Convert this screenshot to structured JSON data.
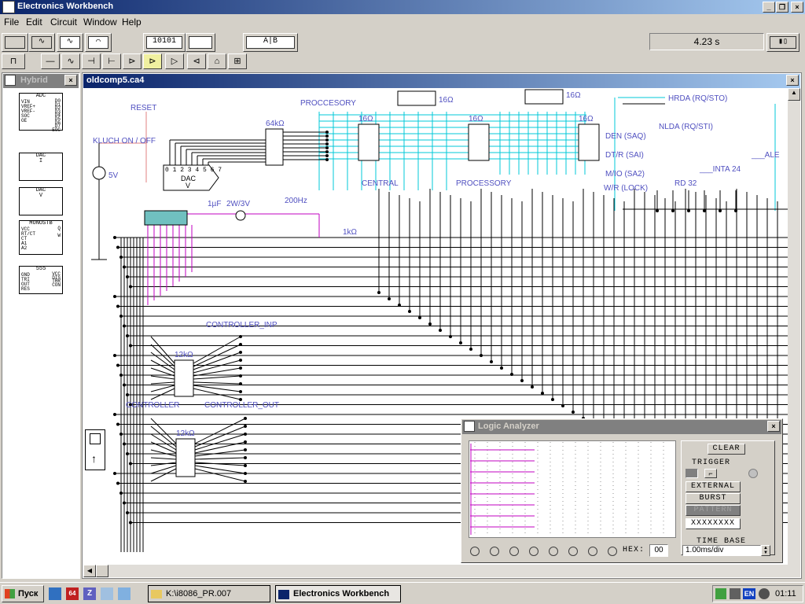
{
  "app": {
    "title": "Electronics Workbench"
  },
  "menu": [
    "File",
    "Edit",
    "Circuit",
    "Window",
    "Help"
  ],
  "toolbar": {
    "word_generator_label": "10101",
    "logic_converter_label": "A|B",
    "simulation_time": "4.23 s"
  },
  "parts_bin": {
    "title": "Hybrid",
    "components": [
      {
        "name": "ADC",
        "pins_left": "VIN\nVREF+\nVREF-\nSOC\nOE",
        "pins_right": "D0\nD1\nD2\nD3\nD4\nD5\nD6\nD7\nEOC"
      },
      {
        "name": "DAC",
        "sub": "I"
      },
      {
        "name": "DAC",
        "sub": "V"
      },
      {
        "name": "MONOSTB",
        "pins_left": "VCC\nRT/CT\nCT\nA1\nA2",
        "pins_right": "Q\n\nW"
      },
      {
        "name": "555",
        "pins_left": "GND\nTRI\nOUT\nRES",
        "pins_right": "VCC\nDIS\nTHR\nCON"
      }
    ]
  },
  "circuit": {
    "window_title": "oldcomp5.ca4",
    "labels": {
      "reset": "RESET",
      "kluch": "KLUCH  ON / OFF",
      "proccesory": "PROCCESORY",
      "central": "CENTRAL",
      "processory": "PROCESSORY",
      "hrda": "HRDA (RQ/STO)",
      "nlda": "NLDA (RQ/STI)",
      "den": "DEN (SAQ)",
      "dtr": "DT/R (SAI)",
      "mio": "M/IO (SA2)",
      "wr": "W/R (LOCK)",
      "rd": "RD  32",
      "inta": "___INTA  24",
      "ale": "___ALE",
      "controller_inp": "CONTROLLER_INP",
      "controller": "CONTROLLER",
      "controller_out": "CONTROLLER_OUT",
      "v5": "5V",
      "cap": "1µF",
      "lamp": "2W/3V",
      "buzzer": "200Hz",
      "r1k": "1kΩ",
      "r64k": "64kΩ",
      "r12k_a": "12kΩ",
      "r12k_b": "12kΩ",
      "r16_1": "16Ω",
      "r16_2": "16Ω",
      "r16_3": "16Ω",
      "r16_4": "16Ω",
      "r16_5": "16Ω",
      "dac_name": "DAC",
      "dac_sub": "V",
      "dac_pins": "0 1 2 3 4 5 6 7",
      "r1k_small": "1kΩ"
    }
  },
  "logic_analyzer": {
    "title": "Logic Analyzer",
    "clear": "CLEAR",
    "trigger": "TRIGGER",
    "external": "EXTERNAL",
    "burst": "BURST",
    "pattern": "PATTERN",
    "pattern_value": "XXXXXXXX",
    "time_base_label": "TIME BASE",
    "time_base_value": "1.00ms/div",
    "hex_label": "HEX:",
    "hex_value": "00"
  },
  "taskbar": {
    "start": "Пуск",
    "tasks": [
      "K:\\i8086_PR.007",
      "Electronics Workbench"
    ],
    "tray_lang": "EN",
    "clock": "01:11"
  },
  "colors": {
    "wire": "#000000",
    "bus": "#00c8d8",
    "probe": "#c000c0",
    "label": "#5050c0",
    "reset_wire": "#e08080"
  }
}
